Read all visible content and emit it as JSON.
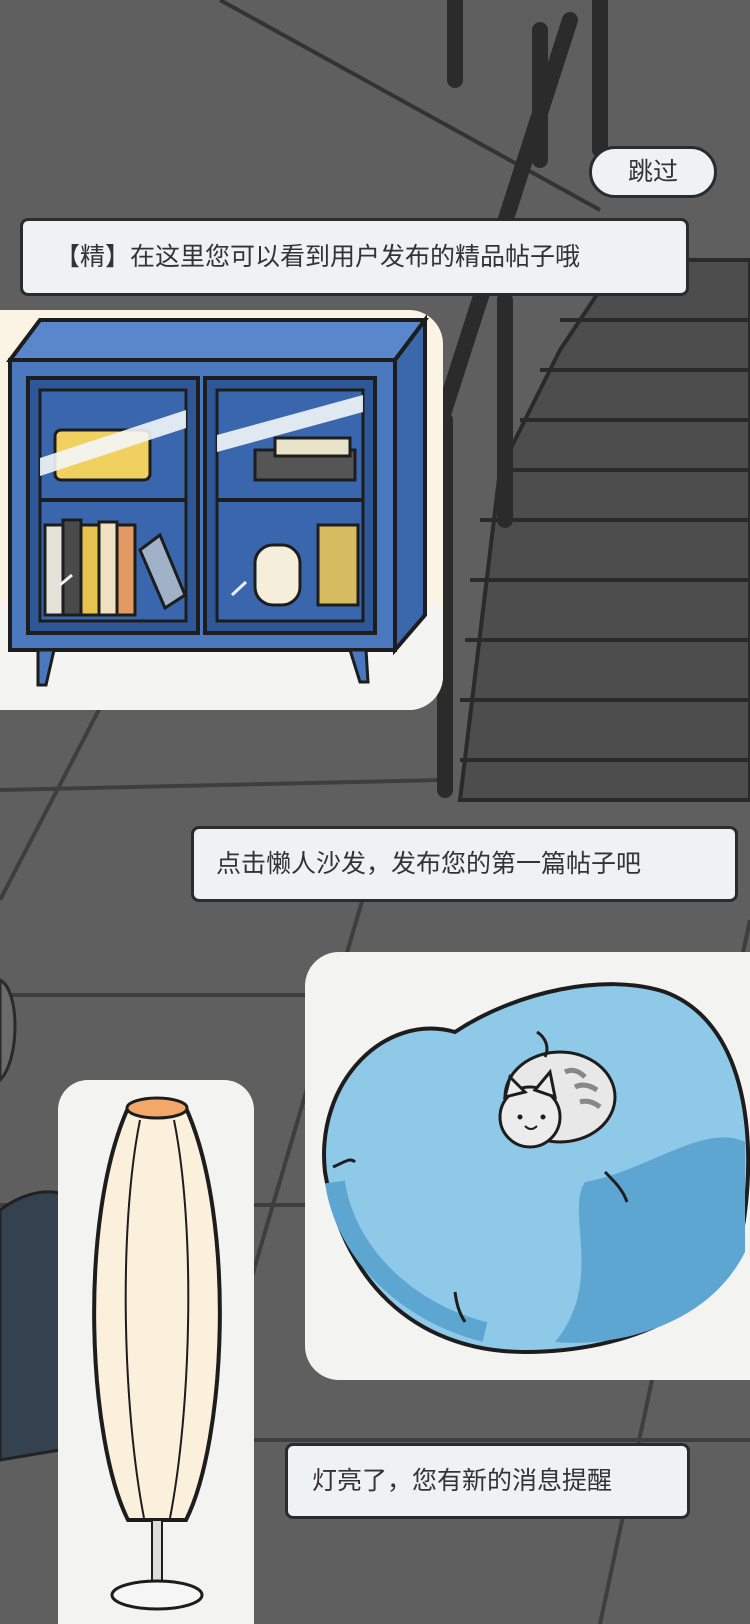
{
  "tutorial": {
    "skip_label": "跳过",
    "steps": [
      {
        "text": "【精】在这里您可以看到用户发布的精品帖子哦"
      },
      {
        "text": "点击懒人沙发，发布您的第一篇帖子吧"
      },
      {
        "text": "灯亮了，您有新的消息提醒"
      }
    ]
  },
  "colors": {
    "overlay": "#5f5f5f",
    "bubble_bg": "#eef2f5",
    "cabinet": "#4a78bf",
    "beanbag": "#8ec9e8",
    "lamp_shade": "#fbf0dc"
  }
}
